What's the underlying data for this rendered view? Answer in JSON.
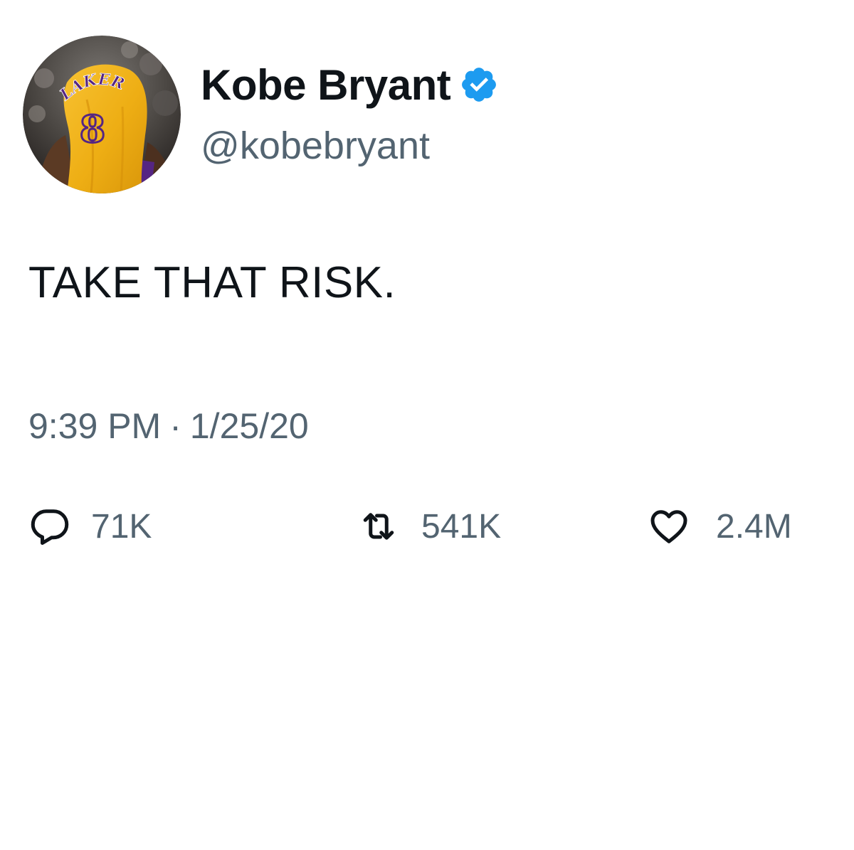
{
  "tweet": {
    "author": {
      "display_name": "Kobe Bryant",
      "handle": "@kobebryant",
      "verified": true,
      "avatar_jersey_text": "LAKERS",
      "avatar_jersey_number": "8"
    },
    "text": "TAKE THAT RISK.",
    "time": "9:39 PM",
    "separator": "·",
    "date": "1/25/20",
    "stats": {
      "replies": "71K",
      "retweets": "541K",
      "likes": "2.4M"
    }
  },
  "icons": {
    "verified": "verified-badge-icon",
    "reply": "speech-bubble-icon",
    "retweet": "retweet-arrows-icon",
    "like": "heart-icon"
  },
  "colors": {
    "text": "#0f1419",
    "secondary": "#536471",
    "verified": "#1d9bf0",
    "jersey": "#f2b418",
    "background": "#ffffff"
  }
}
